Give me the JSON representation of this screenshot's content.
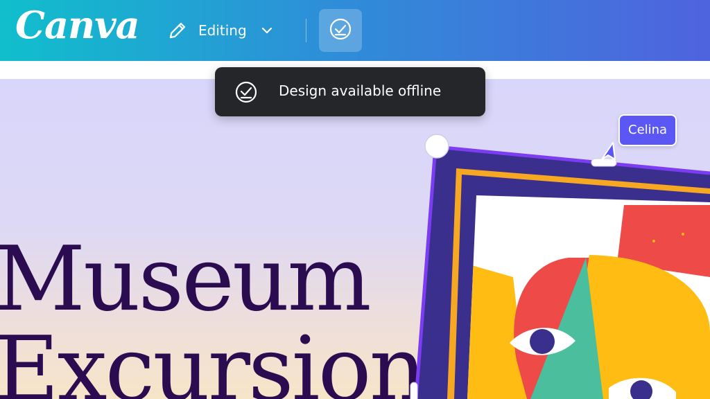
{
  "header": {
    "logo": "Canva",
    "mode_label": "Editing",
    "icons": {
      "edit": "pencil-icon",
      "mode_menu": "chevron-down-icon",
      "sync": "cloud-check-icon"
    }
  },
  "toast": {
    "message": "Design available offline",
    "icon": "check-circle-icon"
  },
  "canvas": {
    "title_line_1": "Museum",
    "title_line_2": "Excursion",
    "collaborator": {
      "name": "Celina",
      "icon": "cursor-icon"
    }
  },
  "colors": {
    "header_gradient_start": "#10bfcc",
    "header_gradient_end": "#4f63de",
    "title_text": "#2c0c50",
    "toast_bg": "#24262a",
    "collaborator": "#5b57f5",
    "frame_navy": "#3a2f8c",
    "frame_orange": "#f7a823",
    "selection": "#7b3cf2",
    "art_red": "#ee4a47",
    "art_yellow": "#ffbd14",
    "art_teal": "#4bbe9e"
  }
}
